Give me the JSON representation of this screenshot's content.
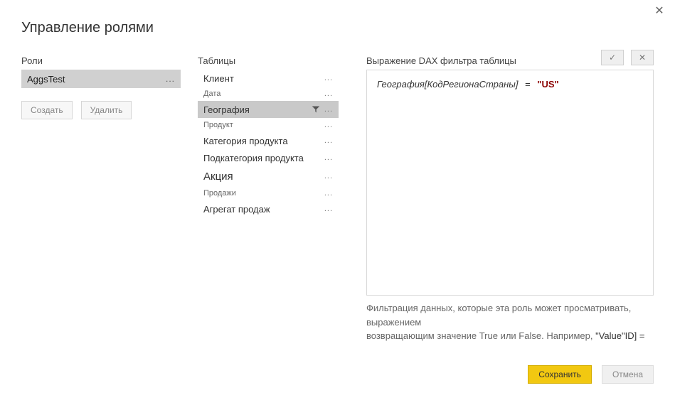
{
  "dialog": {
    "title": "Управление ролями",
    "close_label": "✕"
  },
  "roles": {
    "section_label": "Роли",
    "items": [
      {
        "name": "AggsTest",
        "selected": true
      }
    ],
    "create_label": "Создать",
    "delete_label": "Удалить"
  },
  "tables": {
    "section_label": "Таблицы",
    "items": [
      {
        "name": "Клиент",
        "size": "normal",
        "filtered": false
      },
      {
        "name": "Дата",
        "size": "small",
        "filtered": false
      },
      {
        "name": "География",
        "size": "normal",
        "filtered": true,
        "selected": true
      },
      {
        "name": "Продукт",
        "size": "small",
        "filtered": false
      },
      {
        "name": "Категория продукта",
        "size": "normal",
        "filtered": false
      },
      {
        "name": "Подкатегория продукта",
        "size": "normal",
        "filtered": false
      },
      {
        "name": "Акция",
        "size": "big",
        "filtered": false
      },
      {
        "name": "Продажи",
        "size": "small",
        "filtered": false
      },
      {
        "name": "Агрегат продаж",
        "size": "normal",
        "filtered": false
      }
    ]
  },
  "dax": {
    "section_label": "Выражение DAX фильтра таблицы",
    "confirm_icon": "✓",
    "cancel_icon": "✕",
    "expression": {
      "column": "География[КодРегионаСтраны]",
      "operator": "=",
      "value": "\"US\""
    },
    "hint_line1": "Фильтрация данных, которые эта роль может просматривать, выражением",
    "hint_line2_pre": "возвращающим значение True или False. Например,",
    "hint_line2_val": "\"Value\"",
    "hint_line2_post": "ID] ="
  },
  "footer": {
    "save_label": "Сохранить",
    "cancel_label": "Отмена"
  }
}
